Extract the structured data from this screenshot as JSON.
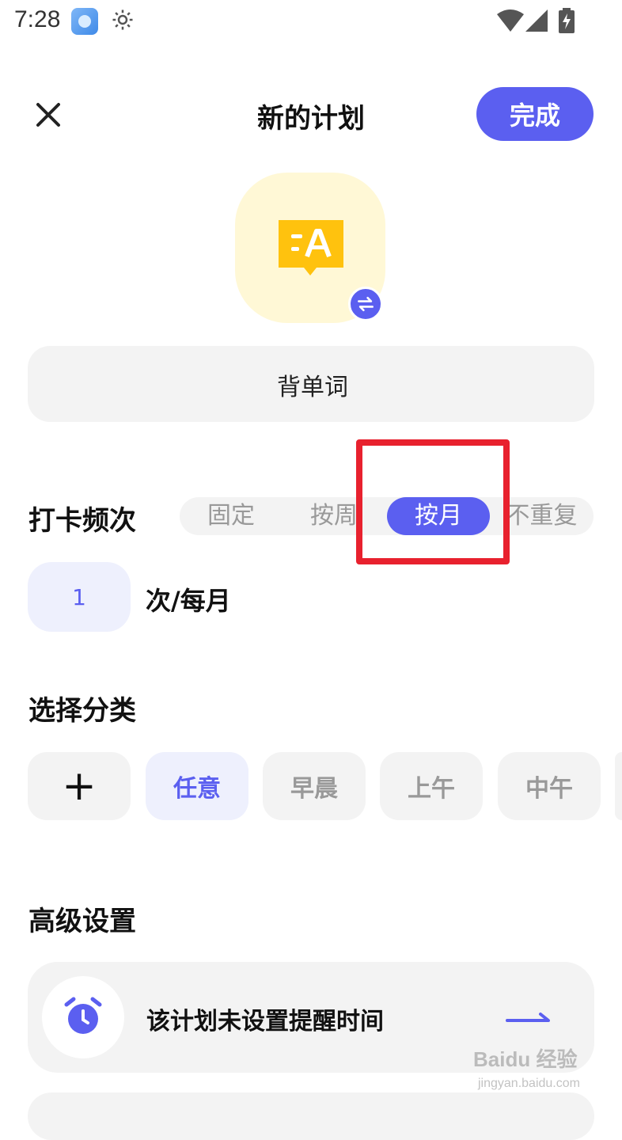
{
  "status_bar": {
    "time": "7:28",
    "icons": [
      "app-icon",
      "gear-icon",
      "wifi-icon",
      "signal-icon",
      "battery-charging-icon"
    ]
  },
  "header": {
    "title": "新的计划",
    "done_label": "完成",
    "close_icon": "close-icon"
  },
  "plan": {
    "icon": "translate-chat-icon",
    "swap_icon": "swap-icon",
    "name_value": "背单词"
  },
  "frequency": {
    "label": "打卡频次",
    "options": [
      "固定",
      "按周",
      "按月",
      "不重复"
    ],
    "selected": "按月",
    "count": "1",
    "unit": "次/每月"
  },
  "category": {
    "label": "选择分类",
    "add_icon": "plus-icon",
    "chips": [
      "任意",
      "早晨",
      "上午",
      "中午"
    ],
    "selected": "任意"
  },
  "advanced": {
    "label": "高级设置",
    "reminder_text": "该计划未设置提醒时间",
    "reminder_icon": "alarm-clock-icon",
    "arrow_icon": "arrow-right-icon"
  },
  "watermark": {
    "text": "Baidu 经验",
    "sub": "jingyan.baidu.com"
  },
  "colors": {
    "accent": "#5b5ff0",
    "accent_light": "#eef0fd",
    "icon_bg": "#fff8d6",
    "icon_yellow": "#ffc20e",
    "highlight_red": "#e8212e",
    "field_bg": "#f3f3f3"
  }
}
